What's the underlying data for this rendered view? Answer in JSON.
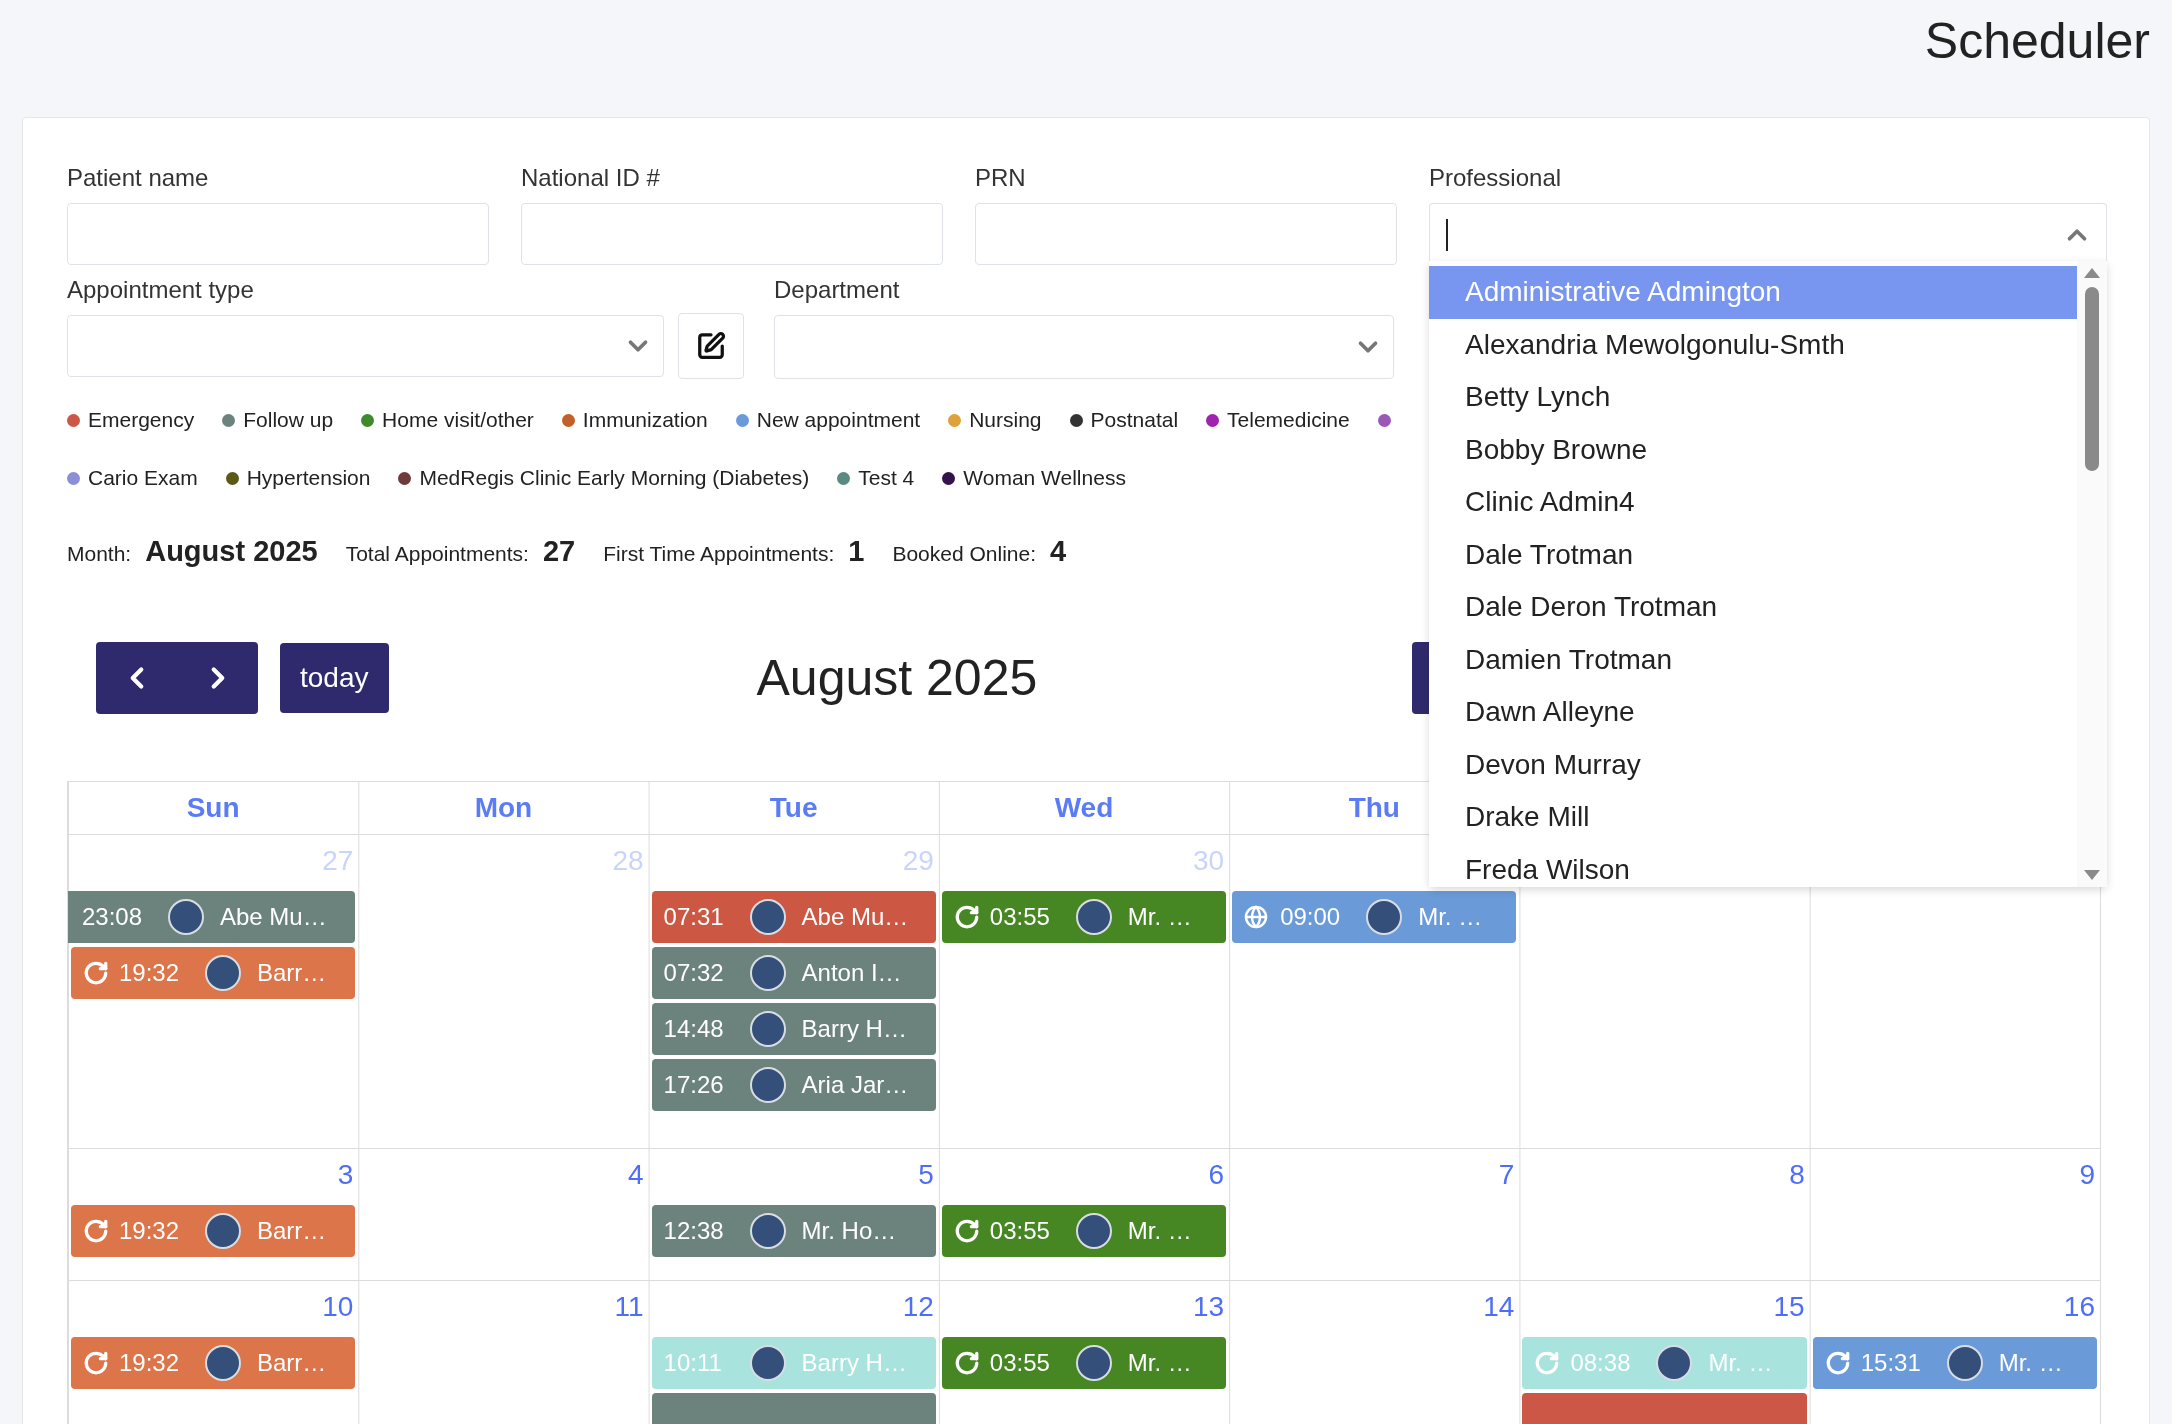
{
  "page_title": "Scheduler",
  "filters": {
    "patient_name": {
      "label": "Patient name"
    },
    "national_id": {
      "label": "National ID #"
    },
    "prn": {
      "label": "PRN"
    },
    "appointment_type": {
      "label": "Appointment type"
    },
    "department": {
      "label": "Department"
    },
    "professional": {
      "label": "Professional",
      "expanded": true,
      "options": [
        {
          "label": "Administrative Admington",
          "selected": true
        },
        {
          "label": "Alexandria Mewolgonulu-Smth",
          "selected": false
        },
        {
          "label": "Betty Lynch",
          "selected": false
        },
        {
          "label": "Bobby Browne",
          "selected": false
        },
        {
          "label": "Clinic Admin4",
          "selected": false
        },
        {
          "label": "Dale Trotman",
          "selected": false
        },
        {
          "label": "Dale Deron Trotman",
          "selected": false
        },
        {
          "label": "Damien Trotman",
          "selected": false
        },
        {
          "label": "Dawn Alleyne",
          "selected": false
        },
        {
          "label": "Devon Murray",
          "selected": false
        },
        {
          "label": "Drake Mill",
          "selected": false
        },
        {
          "label": "Freda Wilson",
          "selected": false
        }
      ]
    }
  },
  "legend_rows": [
    [
      {
        "label": "Emergency",
        "color": "#cd5746"
      },
      {
        "label": "Follow up",
        "color": "#6c837d"
      },
      {
        "label": "Home visit/other",
        "color": "#3f8a2a"
      },
      {
        "label": "Immunization",
        "color": "#c2602c"
      },
      {
        "label": "New appointment",
        "color": "#6a9ad8"
      },
      {
        "label": "Nursing",
        "color": "#e0a03c"
      },
      {
        "label": "Postnatal",
        "color": "#333333"
      },
      {
        "label": "Telemedicine",
        "color": "#a023b0"
      },
      {
        "color": "#9b59b6"
      }
    ],
    [
      {
        "label": "Cario Exam",
        "color": "#8a8fd8"
      },
      {
        "label": "Hypertension",
        "color": "#5a5a16"
      },
      {
        "label": "MedRegis Clinic Early Morning (Diabetes)",
        "color": "#6e3a3a"
      },
      {
        "label": "Test 4",
        "color": "#5a8a84"
      },
      {
        "label": "Woman Wellness",
        "color": "#34124a"
      }
    ]
  ],
  "stats": [
    {
      "label": "Month:",
      "value": "August 2025"
    },
    {
      "label": "Total Appointments:",
      "value": "27"
    },
    {
      "label": "First Time Appointments:",
      "value": "1"
    },
    {
      "label": "Booked Online:",
      "value": "4"
    }
  ],
  "toolbar": {
    "today": "today",
    "title": "August 2025"
  },
  "calendar": {
    "weekdays": [
      "Sun",
      "Mon",
      "Tue",
      "Wed",
      "Thu"
    ],
    "weeks": [
      {
        "days": [
          {
            "number": "27",
            "other_month": true,
            "events": [
              {
                "time": "23:08",
                "name": "Abe Mu…",
                "color": "#6c837d",
                "continued": true
              },
              {
                "kind": "recurring",
                "time": "19:32",
                "name": "Barr…",
                "color": "#dc7549"
              }
            ]
          },
          {
            "number": "28",
            "other_month": true
          },
          {
            "number": "29",
            "other_month": true,
            "events": [
              {
                "time": "07:31",
                "name": "Abe Mu…",
                "color": "#cc5844"
              },
              {
                "time": "07:32",
                "name": "Anton I…",
                "color": "#6c837d"
              },
              {
                "time": "14:48",
                "name": "Barry H…",
                "color": "#6c837d"
              },
              {
                "time": "17:26",
                "name": "Aria Jar…",
                "color": "#6c837d"
              }
            ]
          },
          {
            "number": "30",
            "other_month": true,
            "events": [
              {
                "kind": "recurring",
                "time": "03:55",
                "name": "Mr. …",
                "color": "#468723"
              }
            ]
          },
          {
            "events": [
              {
                "kind": "online",
                "time": "09:00",
                "name": "Mr. …",
                "color": "#6a9ad8"
              }
            ]
          }
        ]
      },
      {
        "days": [
          {
            "number": "3",
            "other_month": false,
            "events": [
              {
                "kind": "recurring",
                "time": "19:32",
                "name": "Barr…",
                "color": "#dc7549"
              }
            ]
          },
          {
            "number": "4",
            "other_month": false
          },
          {
            "number": "5",
            "other_month": false,
            "events": [
              {
                "time": "12:38",
                "name": "Mr. Ho…",
                "color": "#6c837d"
              }
            ]
          },
          {
            "number": "6",
            "other_month": false,
            "events": [
              {
                "kind": "recurring",
                "time": "03:55",
                "name": "Mr. …",
                "color": "#468723"
              }
            ]
          },
          {
            "number": "7",
            "other_month": false
          },
          {
            "number": "8",
            "other_month": false
          },
          {
            "number": "9",
            "other_month": false
          }
        ]
      },
      {
        "days": [
          {
            "number": "10",
            "other_month": false,
            "events": [
              {
                "kind": "recurring",
                "time": "19:32",
                "name": "Barr…",
                "color": "#dc7549"
              }
            ]
          },
          {
            "number": "11",
            "other_month": false
          },
          {
            "number": "12",
            "other_month": false,
            "events": [
              {
                "time": "10:11",
                "name": "Barry H…",
                "color": "#a8e3de"
              },
              {
                "color": "#6c837d"
              }
            ]
          },
          {
            "number": "13",
            "other_month": false,
            "events": [
              {
                "kind": "recurring",
                "time": "03:55",
                "name": "Mr. …",
                "color": "#468723"
              }
            ]
          },
          {
            "number": "14",
            "other_month": false
          },
          {
            "number": "15",
            "other_month": false,
            "events": [
              {
                "kind": "recurring",
                "time": "08:38",
                "name": "Mr. …",
                "color": "#a8e3de"
              },
              {
                "color": "#cd5746"
              }
            ]
          },
          {
            "number": "16",
            "other_month": false,
            "events": [
              {
                "kind": "recurring",
                "time": "15:31",
                "name": "Mr. …",
                "color": "#6a9ad8"
              }
            ]
          }
        ]
      }
    ]
  }
}
